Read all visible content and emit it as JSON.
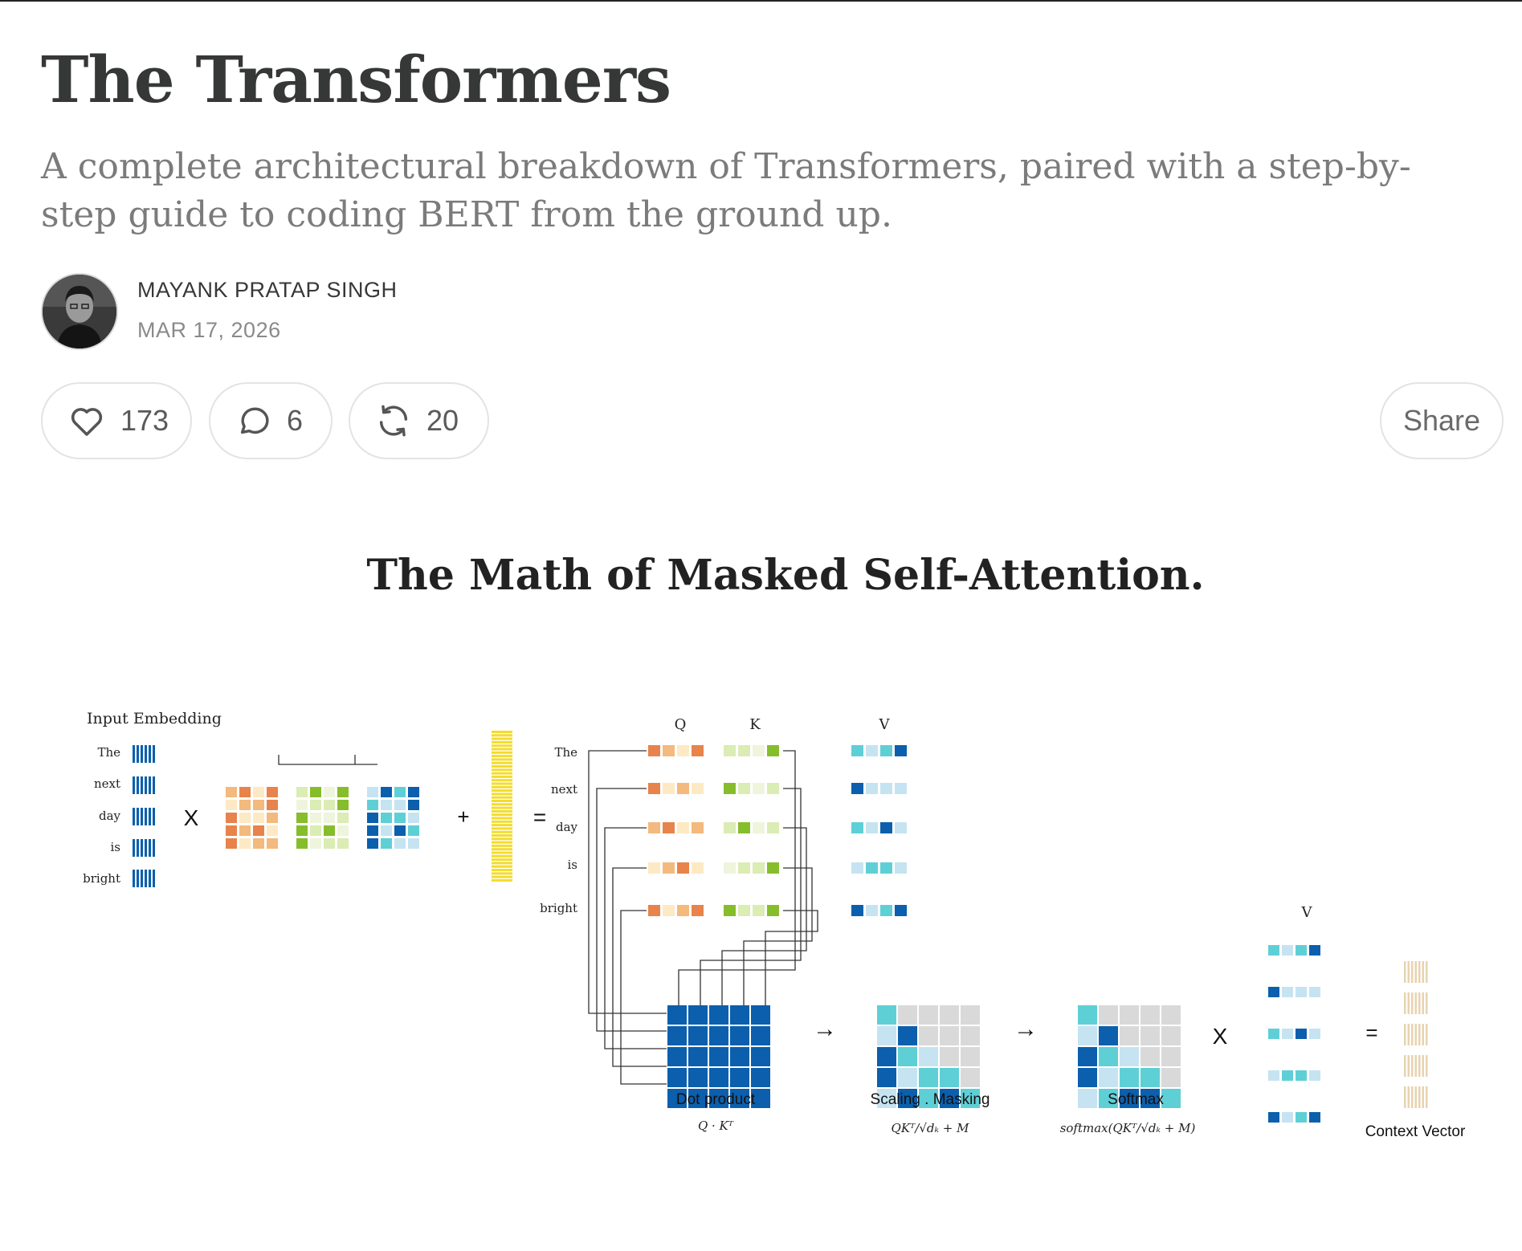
{
  "post": {
    "title": "The Transformers",
    "subtitle": "A complete architectural breakdown of Transformers, paired with a step-by-step guide to coding BERT from the ground up.",
    "author": "MAYANK PRATAP SINGH",
    "date": "MAR 17, 2026"
  },
  "actions": {
    "likes": "173",
    "comments": "6",
    "restacks": "20",
    "share_label": "Share"
  },
  "icons": {
    "like": "heart-icon",
    "comment": "speech-bubble-icon",
    "restack": "restack-arrows-icon"
  },
  "figure": {
    "title": "The Math of Masked Self-Attention.",
    "input_label": "Input Embedding",
    "tokens": [
      "The",
      "next",
      "day",
      "is",
      "bright"
    ],
    "op_multiply": "X",
    "op_plus": "+",
    "op_equals": "=",
    "op_arrow": "→",
    "labels": {
      "q": "Q",
      "k": "K",
      "v": "V",
      "dot_product": "Dot product",
      "dot_formula": "Q · Kᵀ",
      "scaling": "Scaling . Masking",
      "scaling_formula": "QKᵀ/√dₖ + M",
      "softmax": "Softmax",
      "softmax_formula": "softmax(QKᵀ/√dₖ + M)",
      "context": "Context Vector"
    },
    "colors": {
      "orange": "#e8834b",
      "peach": "#f4b97c",
      "cream": "#fde9c4",
      "green": "#86bd2b",
      "lightgreen": "#dbecb4",
      "darkblue": "#0b5fad",
      "teal": "#5fcfd6",
      "lightblue": "#c6e3f2",
      "gray": "#d9d9d9",
      "yellow": "#f3dc2f",
      "tan": "#e8d3b0"
    }
  }
}
